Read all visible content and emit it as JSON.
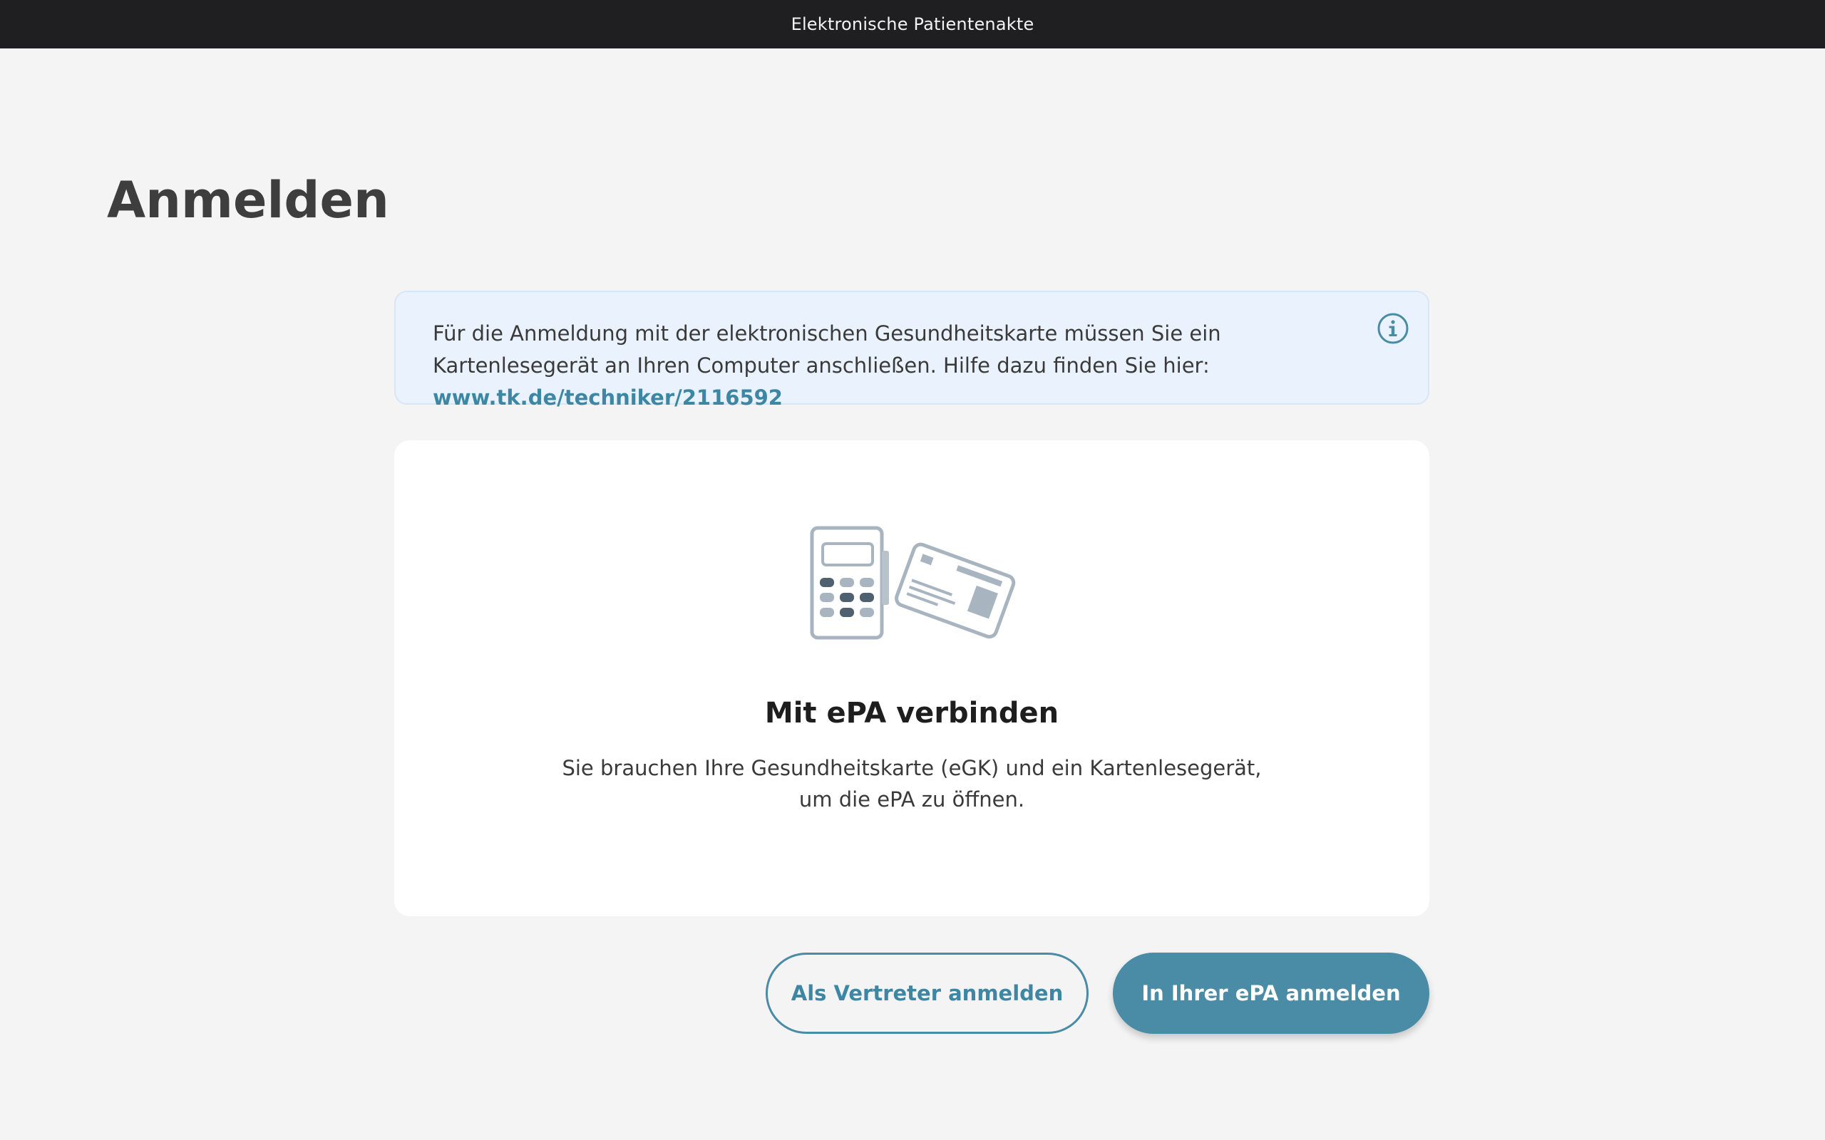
{
  "window": {
    "title": "Elektronische Patientenakte"
  },
  "page": {
    "title": "Anmelden"
  },
  "info_banner": {
    "text": "Für die Anmeldung mit der elektronischen Gesundheitskarte müssen Sie ein Kartenlesegerät an Ihren Computer anschließen. Hilfe dazu finden Sie hier: ",
    "link_text": "www.tk.de/techniker/2116592",
    "icon": "info-icon"
  },
  "card": {
    "illustration": "card-reader-and-health-card",
    "title": "Mit ePA verbinden",
    "description": "Sie brauchen Ihre Gesundheitskarte (eGK) und ein Kartenlesegerät, um die ePA zu öffnen."
  },
  "actions": {
    "representative_label": "Als Vertreter anmelden",
    "login_label": "In Ihrer ePA anmelden"
  },
  "colors": {
    "accent": "#4a8ba5",
    "titlebar": "#1f1f22",
    "info_background": "#eaf3fd",
    "page_background": "#f4f4f4"
  }
}
